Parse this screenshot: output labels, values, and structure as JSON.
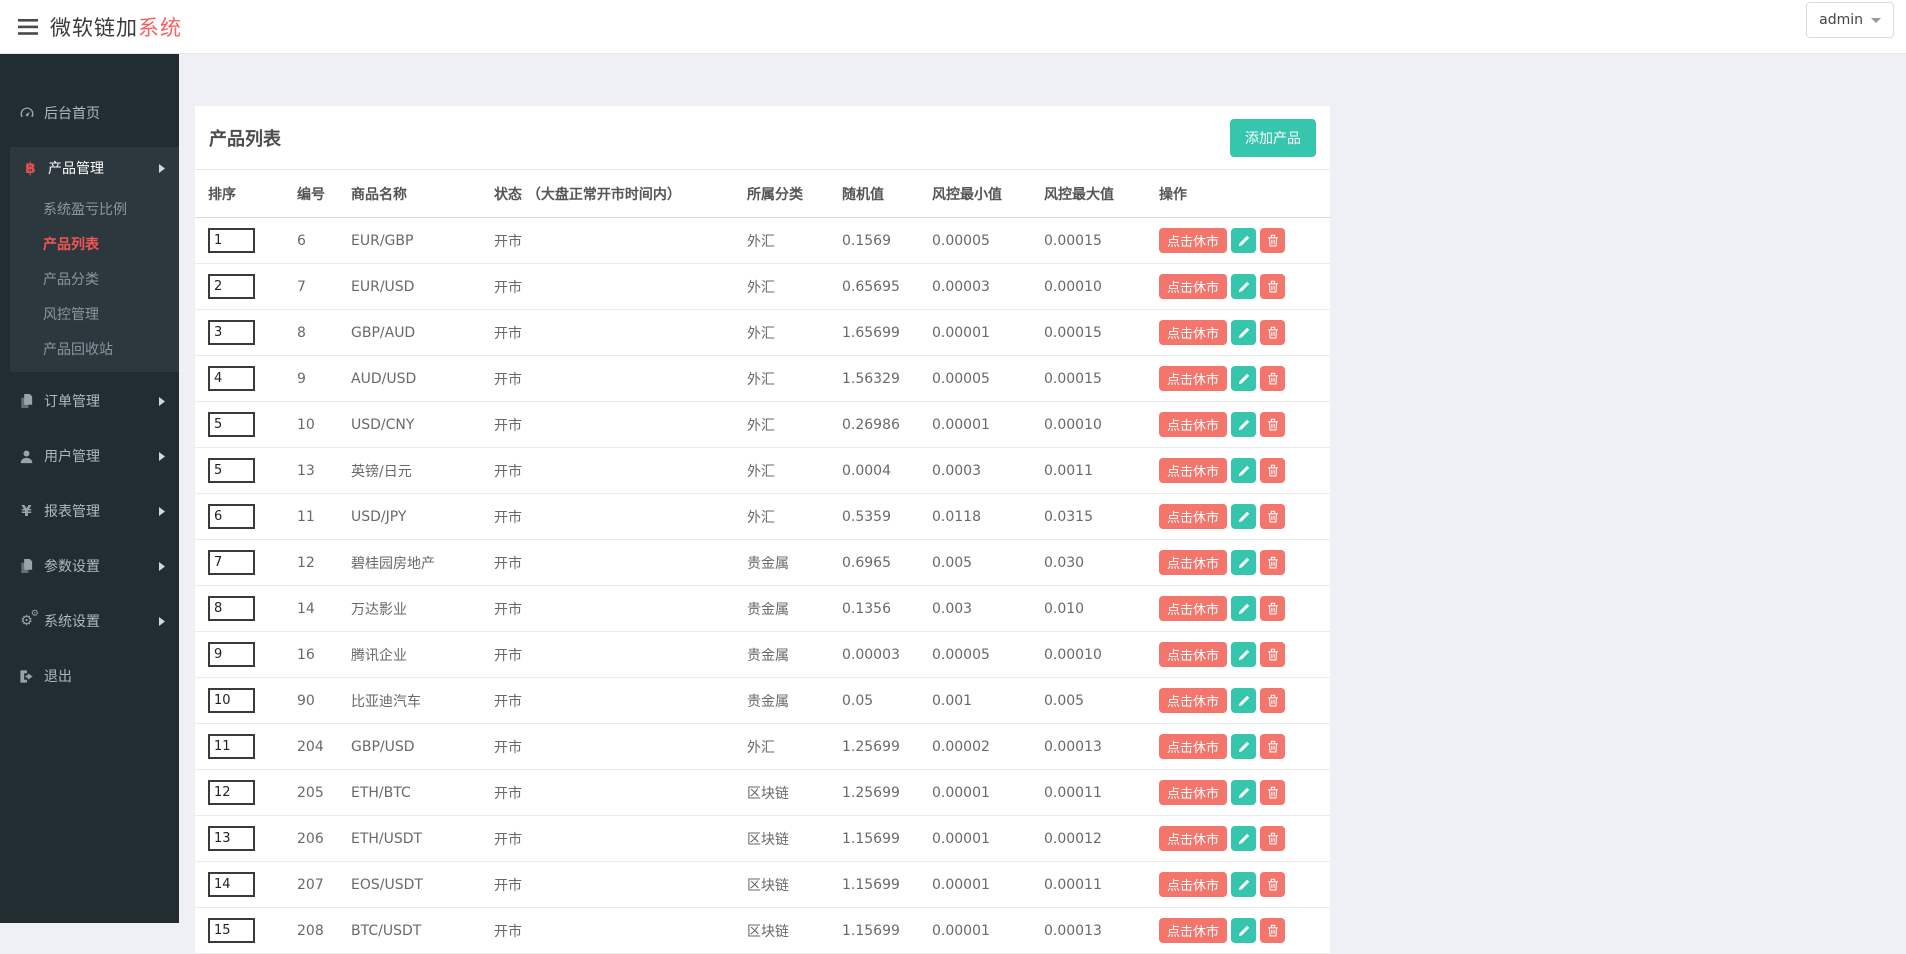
{
  "topbar": {
    "brand_primary": "微软链加",
    "brand_accent": "系统",
    "user_menu": {
      "label": "admin"
    }
  },
  "sidebar": {
    "items": [
      {
        "label": "后台首页",
        "icon": "dashboard-icon"
      },
      {
        "label": "产品管理",
        "icon": "bitcoin-icon",
        "expanded": true,
        "children": [
          {
            "label": "系统盈亏比例",
            "active": false
          },
          {
            "label": "产品列表",
            "active": true
          },
          {
            "label": "产品分类",
            "active": false
          },
          {
            "label": "风控管理",
            "active": false
          },
          {
            "label": "产品回收站",
            "active": false
          }
        ]
      },
      {
        "label": "订单管理",
        "icon": "copy-icon"
      },
      {
        "label": "用户管理",
        "icon": "user-icon"
      },
      {
        "label": "报表管理",
        "icon": "yen-icon"
      },
      {
        "label": "参数设置",
        "icon": "file-icon"
      },
      {
        "label": "系统设置",
        "icon": "gears-icon"
      },
      {
        "label": "退出",
        "icon": "sign-out-icon"
      }
    ]
  },
  "panel": {
    "title": "产品列表",
    "add_button": "添加产品"
  },
  "table": {
    "columns": [
      "排序",
      "编号",
      "商品名称",
      "状态 （大盘正常开市时间内）",
      "所属分类",
      "随机值",
      "风控最小值",
      "风控最大值",
      "操作"
    ],
    "action_labels": {
      "close_market": "点击休市"
    },
    "rows": [
      {
        "sort": "1",
        "id": "6",
        "name": "EUR/GBP",
        "status": "开市",
        "category": "外汇",
        "random": "0.1569",
        "risk_min": "0.00005",
        "risk_max": "0.00015"
      },
      {
        "sort": "2",
        "id": "7",
        "name": "EUR/USD",
        "status": "开市",
        "category": "外汇",
        "random": "0.65695",
        "risk_min": "0.00003",
        "risk_max": "0.00010"
      },
      {
        "sort": "3",
        "id": "8",
        "name": "GBP/AUD",
        "status": "开市",
        "category": "外汇",
        "random": "1.65699",
        "risk_min": "0.00001",
        "risk_max": "0.00015"
      },
      {
        "sort": "4",
        "id": "9",
        "name": "AUD/USD",
        "status": "开市",
        "category": "外汇",
        "random": "1.56329",
        "risk_min": "0.00005",
        "risk_max": "0.00015"
      },
      {
        "sort": "5",
        "id": "10",
        "name": "USD/CNY",
        "status": "开市",
        "category": "外汇",
        "random": "0.26986",
        "risk_min": "0.00001",
        "risk_max": "0.00010"
      },
      {
        "sort": "5",
        "id": "13",
        "name": "英镑/日元",
        "status": "开市",
        "category": "外汇",
        "random": "0.0004",
        "risk_min": "0.0003",
        "risk_max": "0.0011"
      },
      {
        "sort": "6",
        "id": "11",
        "name": "USD/JPY",
        "status": "开市",
        "category": "外汇",
        "random": "0.5359",
        "risk_min": "0.0118",
        "risk_max": "0.0315"
      },
      {
        "sort": "7",
        "id": "12",
        "name": "碧桂园房地产",
        "status": "开市",
        "category": "贵金属",
        "random": "0.6965",
        "risk_min": "0.005",
        "risk_max": "0.030"
      },
      {
        "sort": "8",
        "id": "14",
        "name": "万达影业",
        "status": "开市",
        "category": "贵金属",
        "random": "0.1356",
        "risk_min": "0.003",
        "risk_max": "0.010"
      },
      {
        "sort": "9",
        "id": "16",
        "name": "腾讯企业",
        "status": "开市",
        "category": "贵金属",
        "random": "0.00003",
        "risk_min": "0.00005",
        "risk_max": "0.00010"
      },
      {
        "sort": "10",
        "id": "90",
        "name": "比亚迪汽车",
        "status": "开市",
        "category": "贵金属",
        "random": "0.05",
        "risk_min": "0.001",
        "risk_max": "0.005"
      },
      {
        "sort": "11",
        "id": "204",
        "name": "GBP/USD",
        "status": "开市",
        "category": "外汇",
        "random": "1.25699",
        "risk_min": "0.00002",
        "risk_max": "0.00013"
      },
      {
        "sort": "12",
        "id": "205",
        "name": "ETH/BTC",
        "status": "开市",
        "category": "区块链",
        "random": "1.25699",
        "risk_min": "0.00001",
        "risk_max": "0.00011"
      },
      {
        "sort": "13",
        "id": "206",
        "name": "ETH/USDT",
        "status": "开市",
        "category": "区块链",
        "random": "1.15699",
        "risk_min": "0.00001",
        "risk_max": "0.00012"
      },
      {
        "sort": "14",
        "id": "207",
        "name": "EOS/USDT",
        "status": "开市",
        "category": "区块链",
        "random": "1.15699",
        "risk_min": "0.00001",
        "risk_max": "0.00011"
      },
      {
        "sort": "15",
        "id": "208",
        "name": "BTC/USDT",
        "status": "开市",
        "category": "区块链",
        "random": "1.15699",
        "risk_min": "0.00001",
        "risk_max": "0.00013"
      }
    ]
  },
  "colors": {
    "accent_teal": "#36c6ad",
    "accent_salmon": "#f4756b",
    "brand_red": "#f95f5f",
    "active_link_red": "#f25555",
    "sidebar_bg": "#222d32",
    "page_bg": "#eef0f5"
  }
}
